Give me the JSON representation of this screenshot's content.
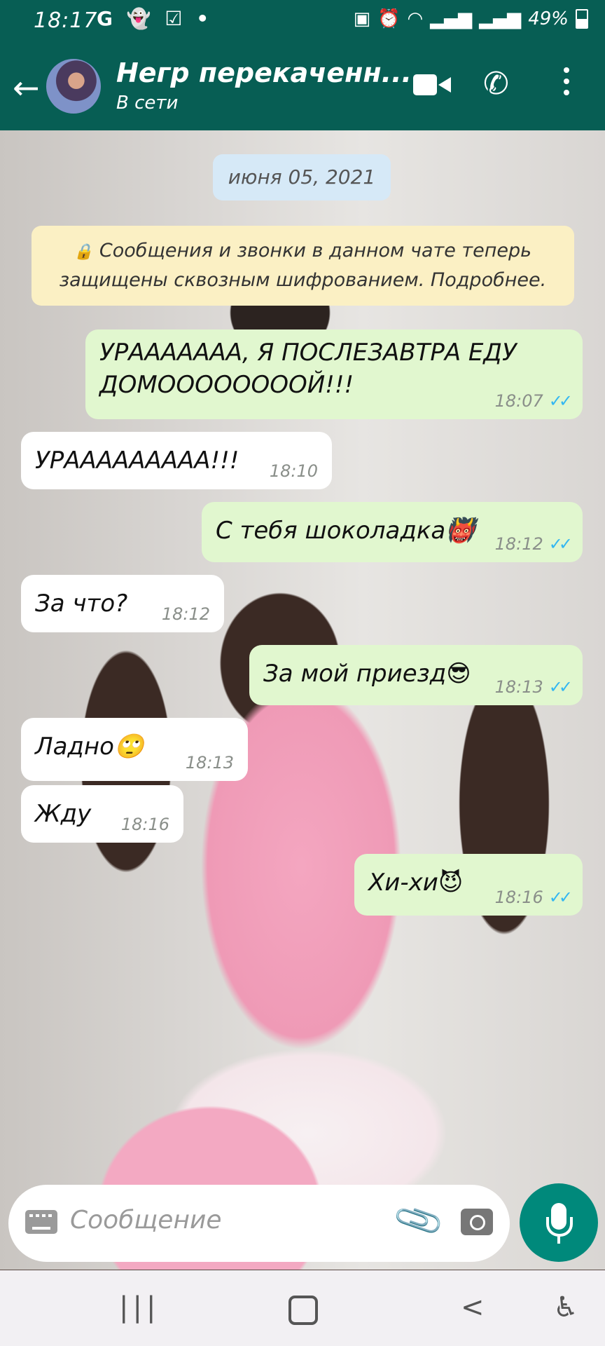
{
  "status_bar": {
    "time": "18:17",
    "icons": [
      "google-icon",
      "snapchat-icon",
      "checkbox-icon",
      "dot"
    ],
    "right_icons": [
      "nfc-icon",
      "alarm-icon",
      "wifi-icon",
      "signal-icon",
      "signal-icon"
    ],
    "battery": "49%"
  },
  "header": {
    "back_icon": "back-arrow-icon",
    "contact_name": "Негр перекаченн...",
    "status": "В сети",
    "video_icon": "video-call-icon",
    "call_icon": "phone-icon",
    "menu_icon": "more-vert-icon"
  },
  "chat": {
    "date": "июня 05, 2021",
    "encryption_notice": "Сообщения и звонки в данном чате теперь защищены сквозным шифрованием. Подробнее.",
    "messages": [
      {
        "dir": "out",
        "line1": "УРААААААА, Я ПОСЛЕЗАВТРА ЕДУ",
        "line2": "ДОМООООООООЙ!!!",
        "time": "18:07",
        "read": true
      },
      {
        "dir": "in",
        "text": "УРААААААААА!!!",
        "time": "18:10"
      },
      {
        "dir": "out",
        "text": "С тебя шоколадка",
        "emoji": "👹",
        "time": "18:12",
        "read": true
      },
      {
        "dir": "in",
        "text": "За что?",
        "time": "18:12"
      },
      {
        "dir": "out",
        "text": "За мой приезд",
        "emoji": "😎",
        "time": "18:13",
        "read": true
      },
      {
        "dir": "in",
        "text": "Ладно",
        "emoji": "🙄",
        "time": "18:13"
      },
      {
        "dir": "in",
        "text": "Жду",
        "time": "18:16"
      },
      {
        "dir": "out",
        "text": "Хи-хи",
        "emoji": "😈",
        "time": "18:16",
        "read": true
      }
    ],
    "read_ticks": "✓✓",
    "tick_color": "#34b7f1"
  },
  "input": {
    "placeholder": "Сообщение",
    "keyboard_icon": "keyboard-icon",
    "attach_icon": "paperclip-icon",
    "camera_icon": "camera-icon",
    "mic_icon": "microphone-icon"
  },
  "colors": {
    "header_bg": "#075e54",
    "outgoing_bubble": "#e1f7cf",
    "incoming_bubble": "#ffffff",
    "mic_button": "#00897b"
  }
}
